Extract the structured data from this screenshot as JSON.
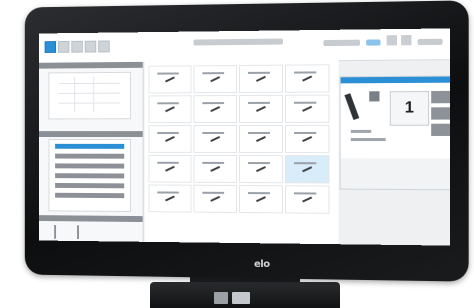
{
  "device": {
    "logo_text": "elo"
  },
  "screen_ui": {
    "selected_value": "1"
  }
}
